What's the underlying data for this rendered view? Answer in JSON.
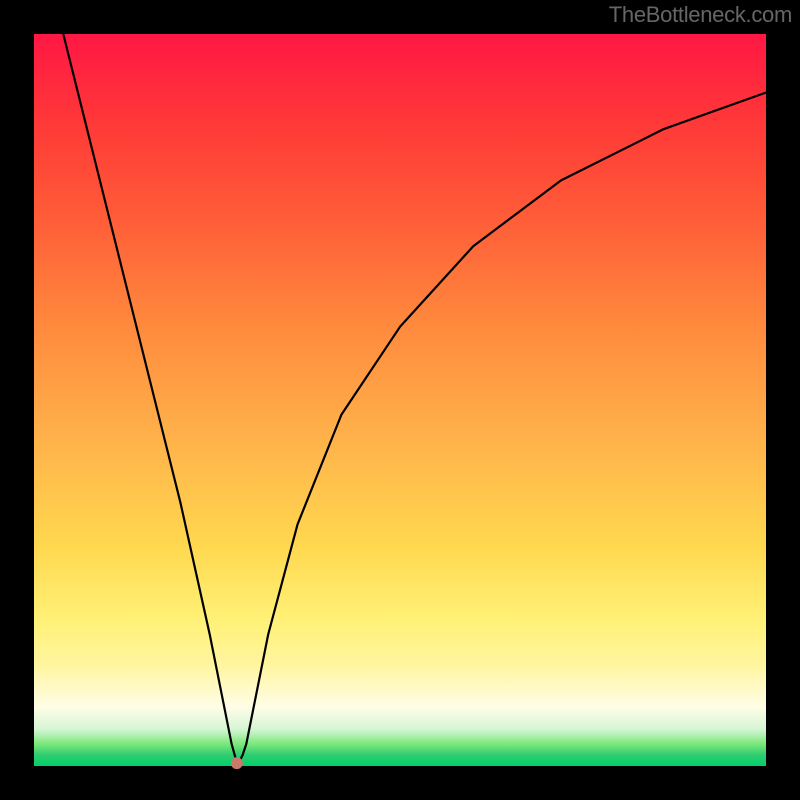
{
  "watermark": "TheBottleneck.com",
  "chart_data": {
    "type": "line",
    "title": "",
    "xlabel": "",
    "ylabel": "",
    "xlim": [
      0,
      100
    ],
    "ylim": [
      0,
      100
    ],
    "grid": false,
    "series": [
      {
        "name": "curve",
        "x": [
          4,
          8,
          12,
          16,
          20,
          24,
          26,
          27,
          27.5,
          28,
          28.5,
          29,
          30,
          32,
          36,
          42,
          50,
          60,
          72,
          86,
          100
        ],
        "y": [
          100,
          84,
          68,
          52,
          36,
          18,
          8,
          3,
          1.2,
          0.5,
          1.5,
          3,
          8,
          18,
          33,
          48,
          60,
          71,
          80,
          87,
          92
        ]
      }
    ],
    "marker": {
      "x": 27.7,
      "y": 0.4
    },
    "gradient_stops": [
      {
        "pos": 0.0,
        "color": "#ff1744"
      },
      {
        "pos": 0.7,
        "color": "#ffeb3b"
      },
      {
        "pos": 1.0,
        "color": "#00d068"
      }
    ]
  }
}
